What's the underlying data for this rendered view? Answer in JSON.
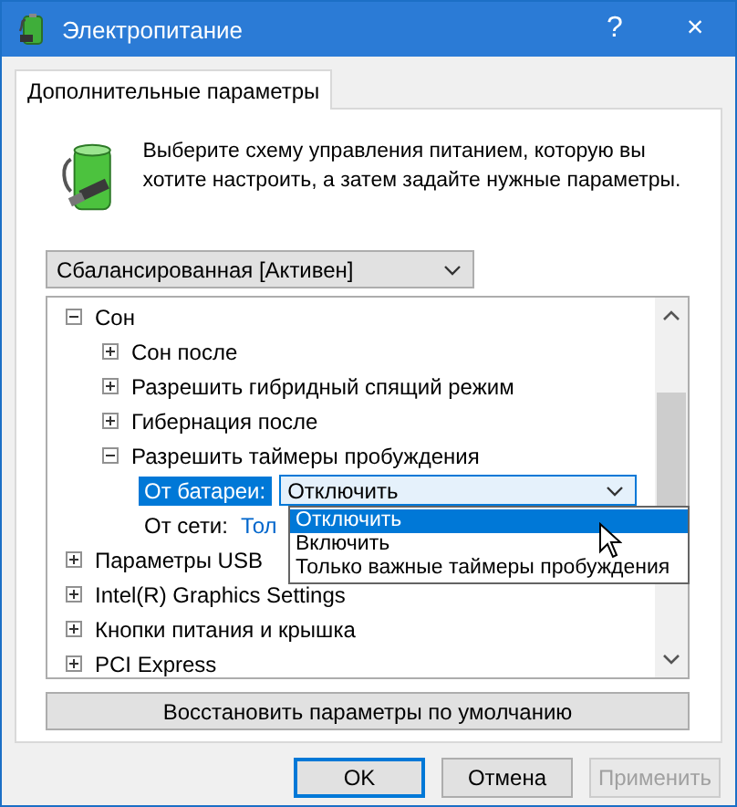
{
  "window": {
    "title": "Электропитание",
    "help": "?",
    "close": "×"
  },
  "tabs": [
    {
      "label": "Дополнительные параметры",
      "selected": true
    }
  ],
  "description": "Выберите схему управления питанием, которую вы хотите настроить, а затем задайте нужные параметры.",
  "scheme_select": {
    "value": "Сбалансированная [Активен]"
  },
  "tree": [
    {
      "label": "Сон",
      "expanded": true,
      "children": [
        {
          "label": "Сон после",
          "expanded": false
        },
        {
          "label": "Разрешить гибридный спящий режим",
          "expanded": false
        },
        {
          "label": "Гибернация после",
          "expanded": false
        },
        {
          "label": "Разрешить таймеры пробуждения",
          "expanded": true,
          "children": [
            {
              "kind": "setting",
              "label": "От батареи:",
              "value": "Отключить",
              "selected": true,
              "editing": true
            },
            {
              "kind": "setting",
              "label": "От сети:",
              "value": "Тол",
              "selected": false,
              "editing": false
            }
          ]
        }
      ]
    },
    {
      "label": "Параметры USB",
      "expanded": false
    },
    {
      "label": "Intel(R) Graphics Settings",
      "expanded": false
    },
    {
      "label": "Кнопки питания и крышка",
      "expanded": false
    },
    {
      "label": "PCI Express",
      "expanded": false
    }
  ],
  "dropdown_list": [
    {
      "label": "Отключить",
      "selected": true
    },
    {
      "label": "Включить",
      "selected": false
    },
    {
      "label": "Только важные таймеры пробуждения",
      "selected": false
    }
  ],
  "restore_button": "Восстановить параметры по умолчанию",
  "buttons": [
    {
      "label": "OK",
      "kind": "default",
      "disabled": false
    },
    {
      "label": "Отмена",
      "kind": "normal",
      "disabled": false
    },
    {
      "label": "Применить",
      "kind": "normal",
      "disabled": true
    }
  ]
}
